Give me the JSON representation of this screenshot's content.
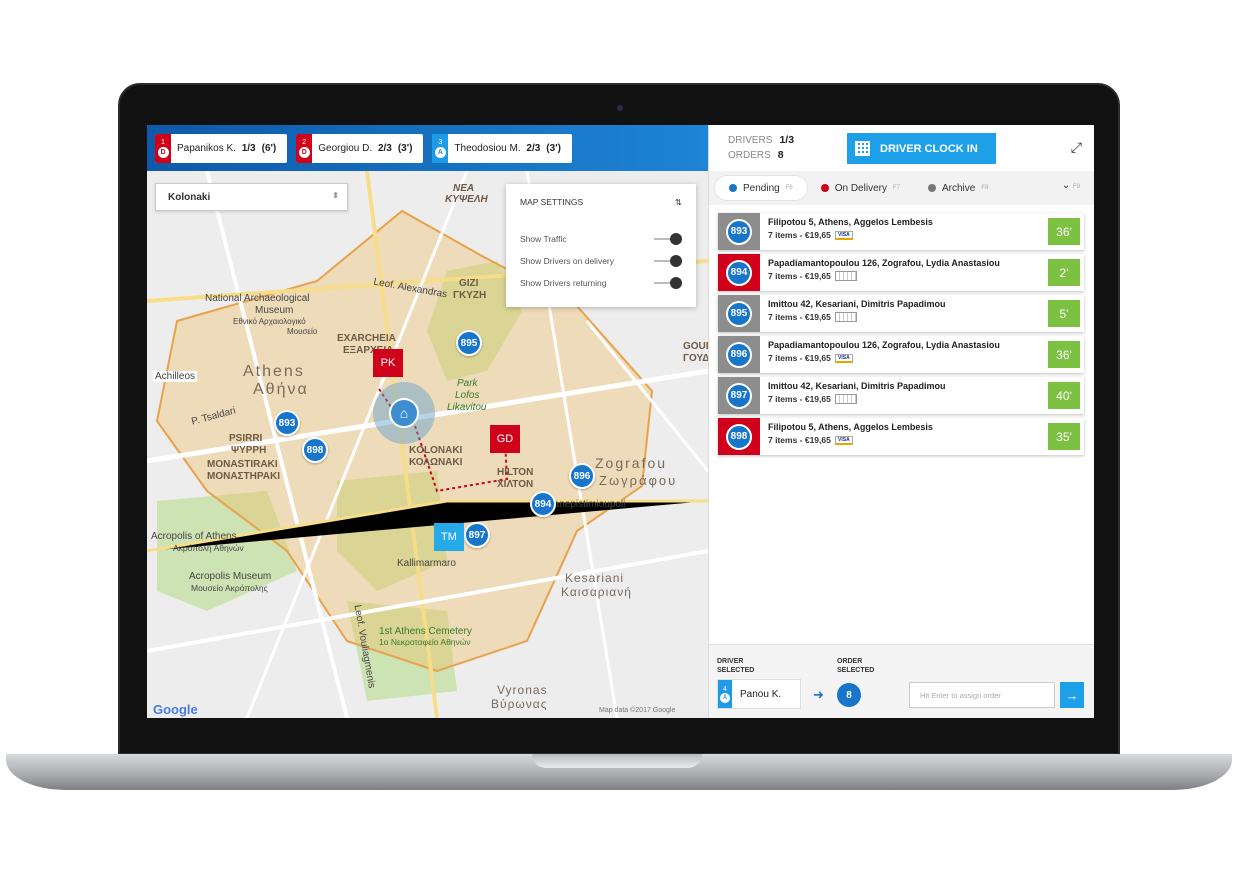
{
  "drivers_bar": [
    {
      "num": "1",
      "letter": "D",
      "name": "Papanikos K.",
      "load": "1/3",
      "eta": "(6')",
      "color": "red"
    },
    {
      "num": "2",
      "letter": "D",
      "name": "Georgiou D.",
      "load": "2/3",
      "eta": "(3')",
      "color": "red"
    },
    {
      "num": "3",
      "letter": "A",
      "name": "Theodosiou M.",
      "load": "2/3",
      "eta": "(3')",
      "color": "blue"
    }
  ],
  "map": {
    "area_select": "Kolonaki",
    "settings": {
      "title": "MAP SETTINGS",
      "options": [
        "Show Traffic",
        "Show Drivers on delivery",
        "Show Drivers returning"
      ]
    },
    "labels": {
      "museum": "National Archaeological",
      "museum2": "Museum",
      "museum_gr": "Εθνικό Αρχαιολογικό",
      "museum_gr2": "Μουσείο",
      "athens": "Athens",
      "athens_gr": "Αθήνα",
      "exarcheia": "EXARCHEIA",
      "exarcheia_gr": "ΕΞΑΡΧΕΙΑ",
      "gizi": "GIZI",
      "gizi_gr": "ΓΚΥΖΗ",
      "psirri": "PSIRRI",
      "psirri_gr": "ΨΥΡΡΗ",
      "monastiraki": "MONASTIRAKI",
      "monastiraki_gr": "ΜΟΝΑΣΤΗΡΑΚΙ",
      "kolonaki": "KOLONAKI",
      "kolonaki_gr": "ΚΟΛΩΝΑΚΙ",
      "hilton": "HILTON",
      "hilton_gr": "ΧΙΛΤΟΝ",
      "zografou": "Zografou",
      "zografou_gr": "Ζωγράφου",
      "acropolis": "Acropolis of Athens",
      "acropolis_gr": "Ακρόπολη Αθηνών",
      "acr_museum": "Acropolis Museum",
      "acr_museum_gr": "Μουσείο Ακρόπολης",
      "kallimarmaro": "Kallimarmaro",
      "kesariani": "Kesariani",
      "kesariani_gr": "Καισαριανή",
      "cemetery": "1st Athens Cemetery",
      "cemetery_gr": "1ο Νεκροταφείο Αθηνών",
      "vyronas": "Vyronas",
      "vyronas_gr": "Βύρωνας",
      "park": "Park",
      "park2": "Lofos",
      "park3": "Likavitou",
      "nea": "ΝΕΑ",
      "nea2": "ΚΥΨΕΛΗ",
      "panepist": "Panepistimioupoli",
      "achilleos": "Achilleos",
      "goud": "GOUD",
      "goud_gr": "ΓΟΥΔΙ",
      "leof_alex": "Leof. Alexandras",
      "tsaldari": "P. Tsaldari",
      "voulagmenis": "Leof. Vouliagmenis",
      "google": "Google",
      "copyright": "Map data ©2017 Google"
    },
    "pins": {
      "893": "893",
      "895": "895",
      "898": "898",
      "896": "896",
      "894": "894",
      "897": "897",
      "pk": "PK",
      "gd": "GD",
      "tm": "TM"
    }
  },
  "panel": {
    "drivers_label": "DRIVERS",
    "drivers_value": "1/3",
    "orders_label": "ORDERS",
    "orders_value": "8",
    "clock_in": "DRIVER CLOCK IN",
    "tabs": [
      {
        "label": "Pending",
        "key": "F6",
        "color": "#1776c9"
      },
      {
        "label": "On Delivery",
        "key": "F7",
        "color": "#d0021b"
      },
      {
        "label": "Archive",
        "key": "F8",
        "color": "#777777"
      }
    ],
    "more_key": "F9",
    "orders": [
      {
        "num": "893",
        "addr": "Filipotou 5, Athens, Aggelos Lembesis",
        "items": "7 items - €19,65",
        "pay": "visa",
        "time": "36'",
        "status": "grey"
      },
      {
        "num": "894",
        "addr": "Papadiamantopoulou 126, Zografou, Lydia Anastasiou",
        "items": "7 items - €19,65",
        "pay": "cash",
        "time": "2'",
        "status": "red"
      },
      {
        "num": "895",
        "addr": "Imittou 42, Kesariani, Dimitris Papadimou",
        "items": "7 items - €19,65",
        "pay": "cash",
        "time": "5'",
        "status": "grey"
      },
      {
        "num": "896",
        "addr": "Papadiamantopoulou 126, Zografou, Lydia Anastasiou",
        "items": "7 items - €19,65",
        "pay": "visa",
        "time": "36'",
        "status": "grey"
      },
      {
        "num": "897",
        "addr": "Imittou 42, Kesariani, Dimitris Papadimou",
        "items": "7 items - €19,65",
        "pay": "cash",
        "time": "40'",
        "status": "grey"
      },
      {
        "num": "898",
        "addr": "Filipotou 5, Athens, Aggelos Lembesis",
        "items": "7 items - €19,65",
        "pay": "visa",
        "time": "35'",
        "status": "red"
      }
    ],
    "assign": {
      "driver_label_1": "DRIVER",
      "driver_label_2": "SELECTED",
      "order_label_1": "ORDER",
      "order_label_2": "SELECTED",
      "driver_num": "4",
      "driver_letter": "A",
      "driver_name": "Panou K.",
      "order_num": "8",
      "placeholder": "Hit Enter to assign order"
    }
  }
}
